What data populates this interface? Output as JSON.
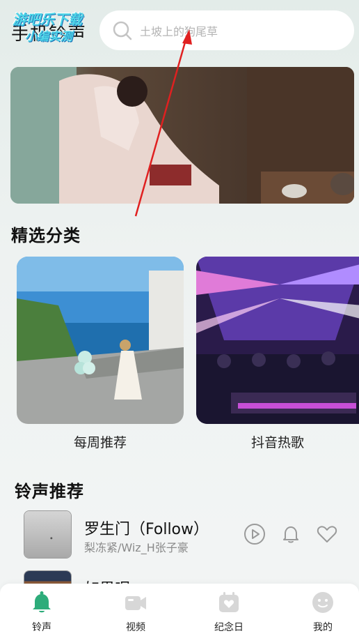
{
  "header": {
    "title": "手机铃声",
    "watermark_line1": "游吧乐下载",
    "watermark_line2": "小编实测"
  },
  "search": {
    "placeholder": "土坡上的狗尾草",
    "icon": "search-icon"
  },
  "sections": {
    "categories_title": "精选分类",
    "ringtones_title": "铃声推荐"
  },
  "categories": [
    {
      "label": "每周推荐"
    },
    {
      "label": "抖音热歌"
    }
  ],
  "ringtones": [
    {
      "title": "罗生门（Follow）",
      "artist": "梨冻紧/Wiz_H张子豪"
    },
    {
      "title": "如果呢",
      "artist": ""
    }
  ],
  "nav": [
    {
      "label": "铃声",
      "icon": "bell-icon",
      "active": true
    },
    {
      "label": "视频",
      "icon": "video-icon",
      "active": false
    },
    {
      "label": "纪念日",
      "icon": "calendar-heart-icon",
      "active": false
    },
    {
      "label": "我的",
      "icon": "profile-icon",
      "active": false
    }
  ],
  "colors": {
    "accent": "#2dac7a",
    "nav_inactive": "#d7d7d7",
    "annotation": "#e02020"
  }
}
